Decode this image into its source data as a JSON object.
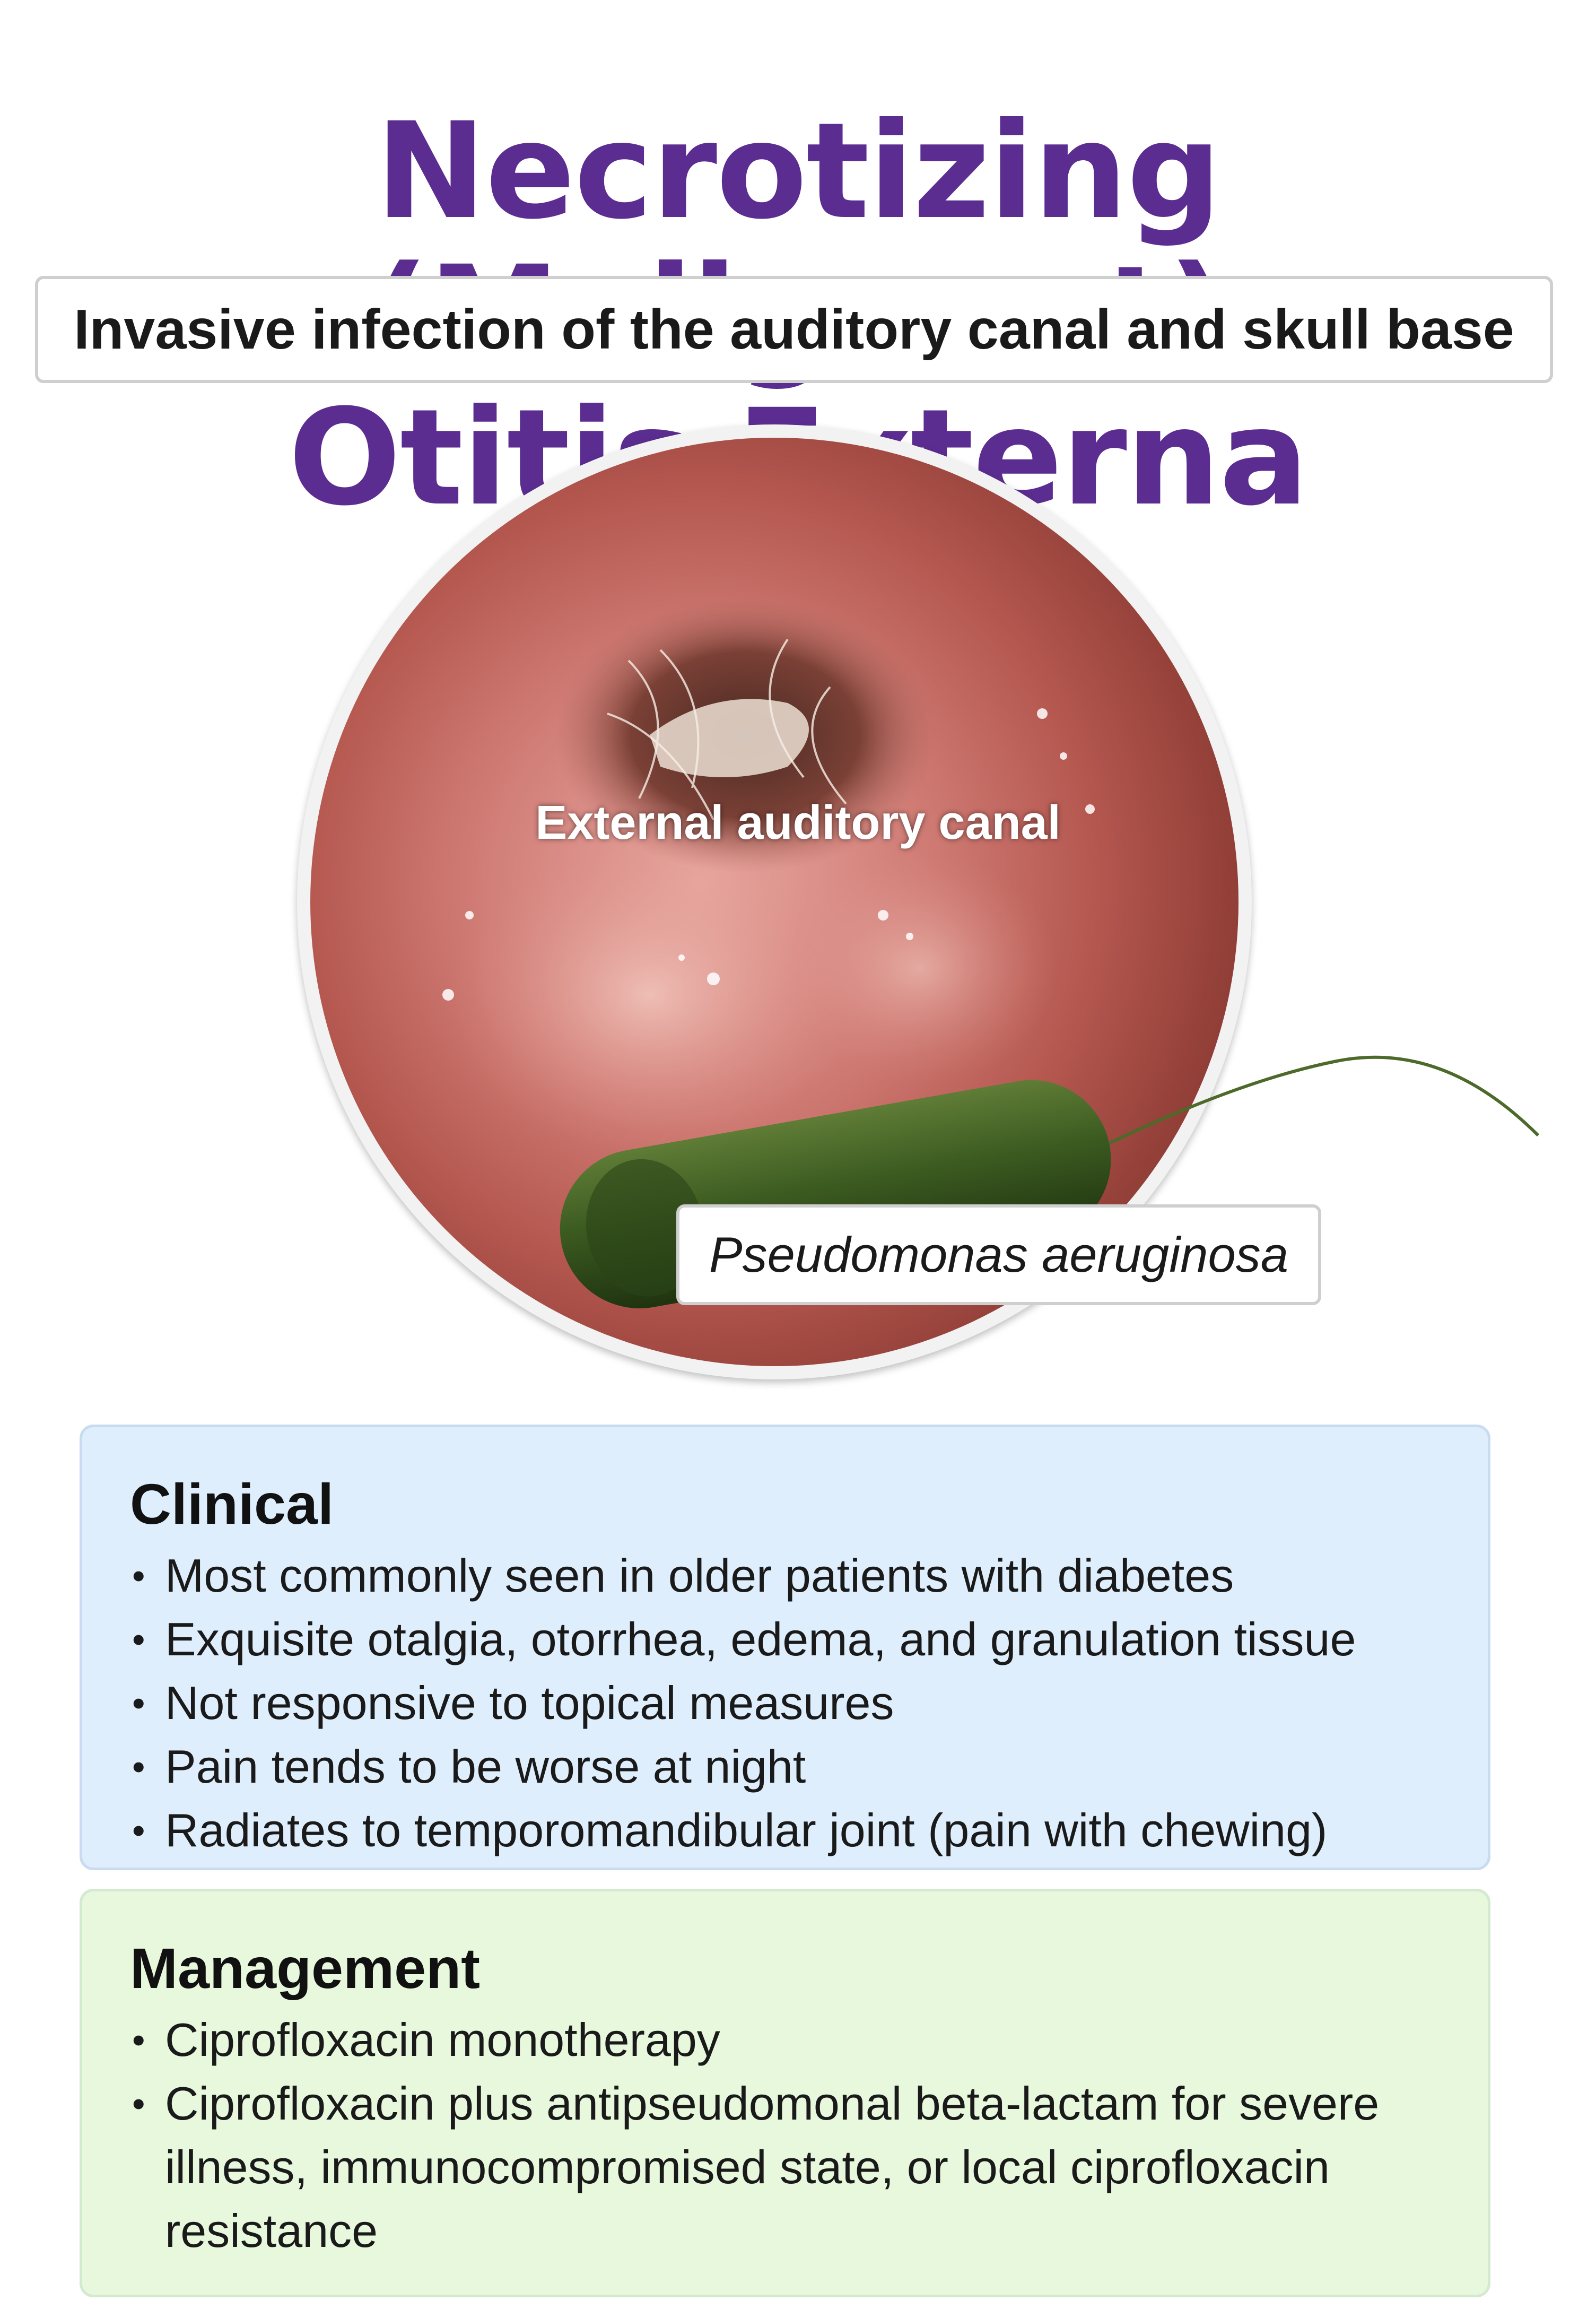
{
  "title": {
    "line1": "Necrotizing (Malignant)",
    "line2": "Otitis Externa"
  },
  "subtitle": "Invasive infection of the auditory canal and skull base",
  "figure": {
    "canal_label": "External auditory canal",
    "organism_label": "Pseudomonas aeruginosa"
  },
  "clinical": {
    "heading": "Clinical",
    "items": [
      "Most commonly seen in older patients with diabetes",
      "Exquisite otalgia, otorrhea, edema, and granulation tissue",
      "Not responsive to topical measures",
      "Pain tends to be worse at night",
      "Radiates to temporomandibular joint (pain with chewing)"
    ]
  },
  "management": {
    "heading": "Management",
    "items": [
      "Ciprofloxacin monotherapy",
      "Ciprofloxacin plus antipseudomonal beta-lactam for severe illness, immunocompromised state, or local ciprofloxacin resistance"
    ]
  },
  "colors": {
    "title": "#5b2d91",
    "clinical_bg": "#dfeefd",
    "management_bg": "#e7f8dd"
  }
}
